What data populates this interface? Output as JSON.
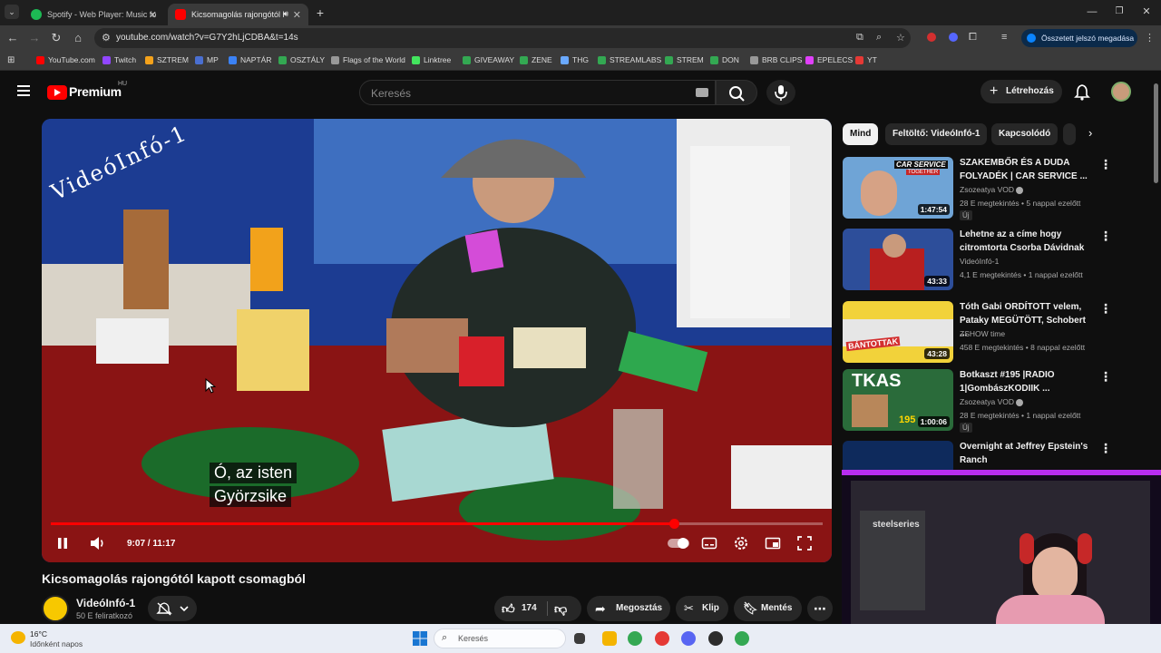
{
  "browser": {
    "tabs": [
      {
        "title": "Spotify - Web Player: Music for",
        "active": false
      },
      {
        "title": "Kicsomagolás rajongótól ka",
        "active": true
      }
    ],
    "url": "youtube.com/watch?v=G7Y2hLjCDBA&t=14s",
    "password_button": "Összetett jelszó megadása",
    "bookmarks": [
      "YouTube.com",
      "Twitch",
      "SZTREM",
      "MP",
      "NAPTÁR",
      "OSZTÁLY",
      "Flags of the World",
      "Linktree",
      "GIVEAWAY",
      "ZENE",
      "THG",
      "STREAMLABS",
      "STREM",
      "DON",
      "BRB CLIPS",
      "EPELECS",
      "YT"
    ]
  },
  "youtube": {
    "logo_text": "Premium",
    "logo_region": "HU",
    "search_placeholder": "Keresés",
    "create_label": "Létrehozás"
  },
  "video": {
    "watermark": "VideóInfó-1",
    "captions": [
      "Ó, az isten",
      "Györzsike"
    ],
    "time": "9:07 / 11:17",
    "progress": 0.807
  },
  "details": {
    "title": "Kicsomagolás rajongótól kapott csomagból",
    "channel": "VideóInfó-1",
    "subscribers": "50 E feliratkozó",
    "likes": "174",
    "share": "Megosztás",
    "clip": "Klip",
    "save": "Mentés"
  },
  "chips": [
    "Mind",
    "Feltöltő: VideóInfó-1",
    "Kapcsolódó"
  ],
  "recommendations": [
    {
      "title": "SZAKEMBŐR ÉS A DUDA FOLYADÉK | CAR SERVICE ...",
      "channel": "Zsozeatya VOD",
      "meta": "28 E megtekintés • 5 nappal ezelőtt",
      "duration": "1:47:54",
      "badge": "Új"
    },
    {
      "title": "Lehetne az a címe hogy citromtorta Csorba Dávidnak",
      "channel": "VideóInfó-1",
      "meta": "4,1 E megtekintés • 1 nappal ezelőtt",
      "duration": "43:33",
      "badge": ""
    },
    {
      "title": "Tóth Gabi ORDÍTOTT velem, Pataky MEGÜTÖTT, Schobert ...",
      "channel": "ZSHOW time",
      "meta": "458 E megtekintés • 8 nappal ezelőtt",
      "duration": "43:28",
      "badge": ""
    },
    {
      "title": "Botkaszt #195 |RADIO 1|GombászKODIIK ...",
      "channel": "Zsozeatya VOD",
      "meta": "28 E megtekintés • 1 nappal ezelőtt",
      "duration": "1:00:06",
      "badge": "Új"
    },
    {
      "title": "Overnight at Jeffrey Epstein's Ranch",
      "channel": "",
      "meta": "",
      "duration": "",
      "badge": ""
    }
  ],
  "rec_thumb_text": [
    "CAR SERVICE",
    "TOGETHER",
    "BÁNTOTTAK",
    "TKAS",
    "195"
  ],
  "taskbar": {
    "temperature": "16°C",
    "weather": "Időnként napos",
    "search": "Keresés"
  },
  "webcam": {
    "brand": "steelseries"
  }
}
